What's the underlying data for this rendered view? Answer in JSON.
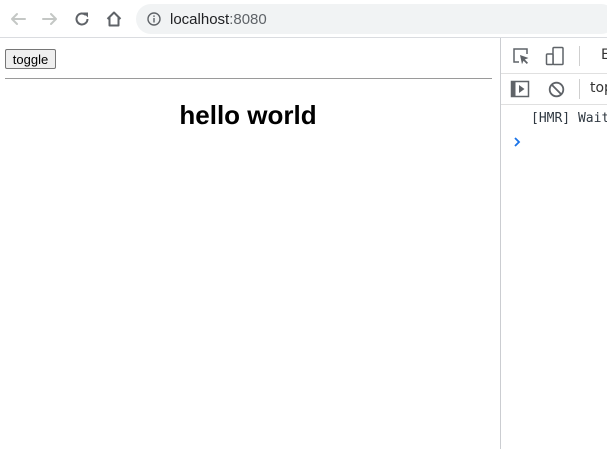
{
  "browser": {
    "url_host": "localhost",
    "url_port": ":8080",
    "icons": [
      "back-arrow-icon",
      "forward-arrow-icon",
      "reload-icon",
      "home-icon",
      "site-info-icon"
    ]
  },
  "page": {
    "toggle_label": "toggle",
    "heading": "hello world"
  },
  "devtools": {
    "panel_tab_partial": "E",
    "context_partial": "top",
    "console_message": "[HMR] Wait",
    "icons": [
      "inspect-element-icon",
      "device-toolbar-icon",
      "sidebar-toggle-icon",
      "clear-console-icon",
      "console-prompt-icon"
    ]
  }
}
